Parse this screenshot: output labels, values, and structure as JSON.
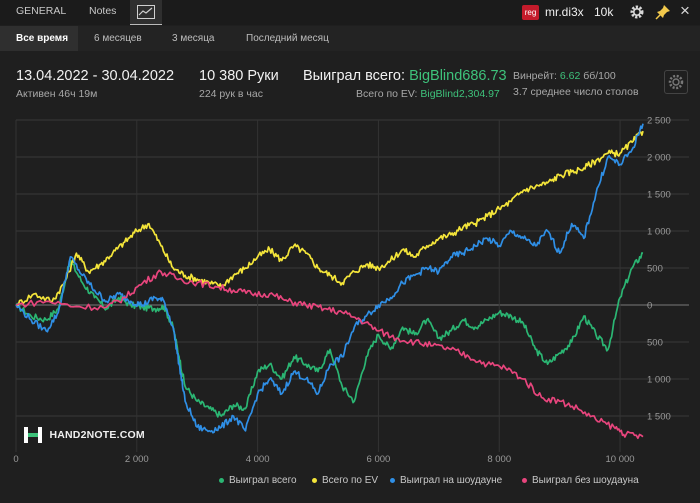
{
  "tabs": {
    "general": "GENERAL",
    "notes": "Notes",
    "graph_icon": "chart-line-icon"
  },
  "user": {
    "badge": "reg",
    "name": "mr.di3x",
    "limit": "10k"
  },
  "periods": [
    "Все время",
    "6 месяцев",
    "3 месяца",
    "Последний месяц"
  ],
  "stats": {
    "dates": "13.04.2022 - 30.04.2022",
    "active": "Активен 46ч 19м",
    "hands": "10 380 Руки",
    "per_hour": "224 рук в час",
    "won_label": "Выиграл всего:",
    "won_value": "BigBlind686.73",
    "ev_label": "Всего по EV:",
    "ev_value": "BigBlind2,304.97",
    "winrate_label": "Винрейт:",
    "winrate_value": "6.62",
    "winrate_unit": "бб/100",
    "tables": "3.7 среднее число столов"
  },
  "logo": "HAND2NOTE.COM",
  "chart_data": {
    "type": "line",
    "xlim": [
      0,
      10380
    ],
    "ylim": [
      -1800,
      2500
    ],
    "x_ticks": [
      0,
      2000,
      4000,
      6000,
      8000,
      10000
    ],
    "x_tick_labels": [
      "0",
      "2 000",
      "4 000",
      "6 000",
      "8 000",
      "10 000"
    ],
    "y_ticks": [
      2500,
      2000,
      1500,
      1000,
      500,
      0,
      -500,
      -1000,
      -1500
    ],
    "y_tick_labels": [
      "2 500",
      "2 000",
      "1 500",
      "1 000",
      "500",
      "0",
      "500",
      "1 000",
      "1 500"
    ],
    "grid": true,
    "legend": "bottom-right",
    "series": [
      {
        "name": "Выиграл всего",
        "color": "#2bb673",
        "x": [
          0,
          250,
          500,
          700,
          900,
          1100,
          1300,
          1500,
          1700,
          1900,
          2100,
          2300,
          2450,
          2600,
          2700,
          2800,
          3000,
          3200,
          3400,
          3600,
          3800,
          4000,
          4200,
          4400,
          4600,
          4800,
          5000,
          5200,
          5400,
          5600,
          5800,
          6000,
          6200,
          6400,
          6600,
          6800,
          7000,
          7200,
          7400,
          7600,
          7800,
          8000,
          8200,
          8400,
          8600,
          8800,
          9000,
          9200,
          9400,
          9600,
          9800,
          10000,
          10200,
          10380
        ],
        "y": [
          0,
          -150,
          -200,
          -50,
          600,
          300,
          100,
          -50,
          100,
          0,
          -30,
          -50,
          -20,
          -300,
          -700,
          -1100,
          -1300,
          -1400,
          -1500,
          -1350,
          -1400,
          -900,
          -800,
          -1000,
          -700,
          -800,
          -900,
          -600,
          -1100,
          -1300,
          -700,
          -400,
          -600,
          -300,
          -400,
          -200,
          -450,
          -350,
          -200,
          -300,
          -200,
          -100,
          -150,
          -250,
          -600,
          -800,
          -650,
          -500,
          -150,
          -400,
          -600,
          100,
          500,
          700
        ]
      },
      {
        "name": "Всего по EV",
        "color": "#f4e53a",
        "x": [
          0,
          300,
          600,
          800,
          1000,
          1200,
          1400,
          1600,
          1800,
          2000,
          2200,
          2400,
          2600,
          2800,
          3000,
          3200,
          3400,
          3600,
          3800,
          4000,
          4200,
          4400,
          4600,
          4800,
          5000,
          5200,
          5400,
          5600,
          5800,
          6000,
          6200,
          6400,
          6600,
          6800,
          7000,
          7200,
          7400,
          7600,
          7800,
          8000,
          8200,
          8400,
          8600,
          8800,
          9000,
          9200,
          9400,
          9600,
          9800,
          10000,
          10200,
          10380
        ],
        "y": [
          0,
          150,
          50,
          300,
          700,
          450,
          550,
          700,
          850,
          1000,
          1100,
          800,
          500,
          400,
          350,
          300,
          250,
          400,
          500,
          650,
          750,
          600,
          800,
          700,
          500,
          400,
          300,
          450,
          550,
          500,
          600,
          750,
          650,
          800,
          900,
          950,
          1050,
          1100,
          1200,
          1300,
          1400,
          1550,
          1600,
          1650,
          1750,
          1800,
          1850,
          1950,
          2050,
          2050,
          2200,
          2350
        ]
      },
      {
        "name": "Выиграл на шоудауне",
        "color": "#2f8fe6",
        "x": [
          0,
          250,
          500,
          700,
          900,
          1100,
          1300,
          1500,
          1700,
          1900,
          2100,
          2300,
          2450,
          2600,
          2700,
          2800,
          3000,
          3200,
          3400,
          3600,
          3800,
          4000,
          4200,
          4400,
          4600,
          4800,
          5000,
          5200,
          5400,
          5600,
          5800,
          6000,
          6200,
          6400,
          6600,
          6800,
          7000,
          7200,
          7400,
          7600,
          7800,
          8000,
          8200,
          8400,
          8600,
          8800,
          9000,
          9200,
          9400,
          9600,
          9800,
          10000,
          10200,
          10380
        ],
        "y": [
          0,
          -200,
          -350,
          -100,
          650,
          400,
          200,
          50,
          150,
          50,
          0,
          100,
          50,
          -300,
          -800,
          -1300,
          -1650,
          -1700,
          -1650,
          -1500,
          -1700,
          -1200,
          -1000,
          -1200,
          -900,
          -1000,
          -1200,
          -800,
          -700,
          -300,
          -150,
          0,
          100,
          300,
          400,
          500,
          450,
          650,
          700,
          800,
          900,
          800,
          1000,
          900,
          800,
          1000,
          700,
          1100,
          900,
          1500,
          2000,
          1900,
          2100,
          2450
        ]
      },
      {
        "name": "Выиграл без шоудауна",
        "color": "#e8457d",
        "x": [
          0,
          500,
          1000,
          1500,
          1800,
          2100,
          2400,
          2700,
          3000,
          3300,
          3600,
          3900,
          4200,
          4500,
          4800,
          5100,
          5400,
          5700,
          6000,
          6300,
          6600,
          6900,
          7200,
          7500,
          7800,
          8100,
          8400,
          8700,
          9000,
          9300,
          9600,
          9900,
          10100,
          10380
        ],
        "y": [
          0,
          50,
          -20,
          -30,
          100,
          300,
          450,
          350,
          300,
          250,
          200,
          150,
          150,
          50,
          0,
          -50,
          -100,
          -200,
          -350,
          -450,
          -500,
          -550,
          -600,
          -700,
          -800,
          -850,
          -1000,
          -1250,
          -1300,
          -1400,
          -1550,
          -1650,
          -1750,
          -1780
        ]
      }
    ]
  }
}
